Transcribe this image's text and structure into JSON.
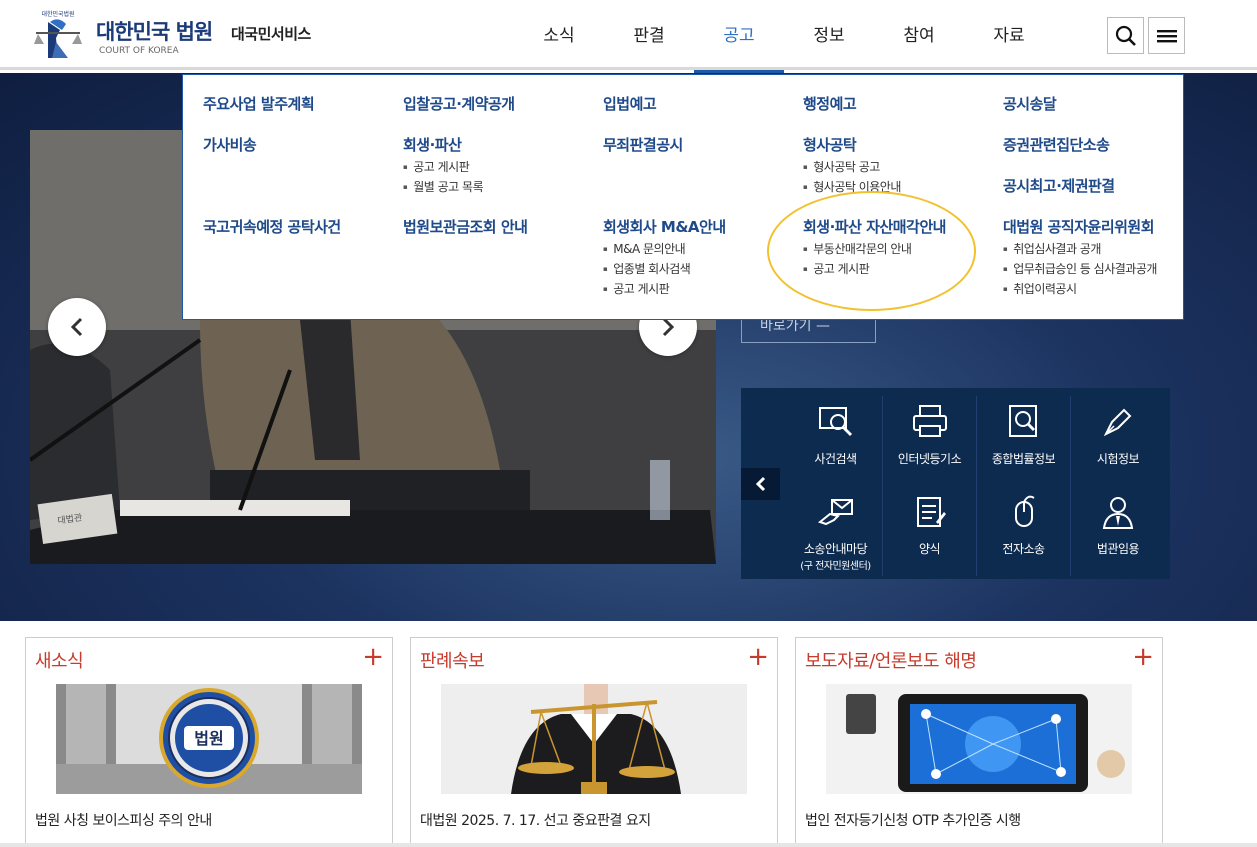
{
  "header": {
    "logo_emblem_text": "대한민국법원",
    "logo_ko": "대한민국 법원",
    "logo_en": "COURT OF KOREA",
    "service": "대국민서비스",
    "nav": [
      "소식",
      "판결",
      "공고",
      "정보",
      "참여",
      "자료"
    ],
    "active_nav": "공고",
    "search_icon": "search-icon",
    "menu_icon": "hamburger-icon"
  },
  "mega_menu": {
    "col1": {
      "a": "주요사업 발주계획",
      "b": "가사비송",
      "c": "국고귀속예정 공탁사건"
    },
    "col2": {
      "a": "입찰공고·계약공개",
      "b": "회생·파산",
      "b_subs": [
        "공고 게시판",
        "월별 공고 목록"
      ],
      "c": "법원보관금조회 안내"
    },
    "col3": {
      "a": "입법예고",
      "b": "무죄판결공시",
      "c": "회생회사 M&A안내",
      "c_subs": [
        "M&A 문의안내",
        "업종별 회사검색",
        "공고 게시판"
      ]
    },
    "col4": {
      "a": "행정예고",
      "b": "형사공탁",
      "b_subs": [
        "형사공탁 공고",
        "형사공탁 이용안내"
      ],
      "c": "회생·파산 자산매각안내",
      "c_subs": [
        "부동산매각문의 안내",
        "공고 게시판"
      ]
    },
    "col5": {
      "a": "공시송달",
      "b": "증권관련집단소송",
      "b2": "공시최고·제권판결",
      "c": "대법원 공직자윤리위원회",
      "c_subs": [
        "취업심사결과 공개",
        "업무취급승인 등 심사결과공개",
        "취업이력공시"
      ]
    },
    "highlight_color": "#f2c12e"
  },
  "hero": {
    "goto_label": "바로가기",
    "nameplate": "대법관"
  },
  "quick": {
    "items": [
      {
        "label": "사건검색",
        "icon": "case-search-icon"
      },
      {
        "label": "인터넷등기소",
        "icon": "printer-icon"
      },
      {
        "label": "종합법률정보",
        "icon": "law-info-icon"
      },
      {
        "label": "시험정보",
        "icon": "pen-icon"
      },
      {
        "label": "소송안내마당",
        "sub": "(구 전자민원센터)",
        "icon": "hand-mail-icon"
      },
      {
        "label": "양식",
        "icon": "form-icon"
      },
      {
        "label": "전자소송",
        "icon": "mouse-icon"
      },
      {
        "label": "법관임용",
        "icon": "judge-icon"
      }
    ]
  },
  "news": [
    {
      "title": "새소식",
      "text": "법원 사칭 보이스피싱 주의 안내",
      "emblem": "법원"
    },
    {
      "title": "판례속보",
      "text": "대법원 2025. 7. 17. 선고 중요판결 요지"
    },
    {
      "title": "보도자료/언론보도 해명",
      "text": "법인 전자등기신청 OTP 추가인증 시행"
    }
  ],
  "colors": {
    "brand": "#1b3a78",
    "accent": "#2f6fc4",
    "news_title": "#c73b2c"
  }
}
